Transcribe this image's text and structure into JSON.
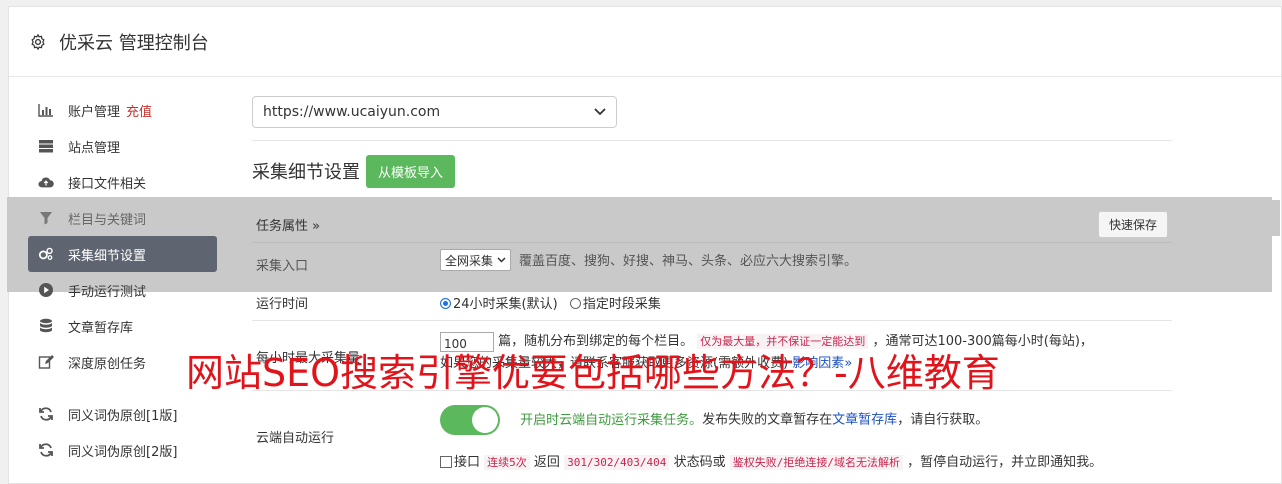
{
  "header": {
    "title": "优采云 管理控制台",
    "icon": "gear-icon"
  },
  "sidebar": {
    "items": [
      {
        "label": "账户管理",
        "extra": "充值",
        "icon": "bar-chart-icon"
      },
      {
        "label": "站点管理",
        "icon": "server-icon"
      },
      {
        "label": "接口文件相关",
        "icon": "cloud-upload-icon"
      },
      {
        "label": "栏目与关键词",
        "icon": "filter-icon"
      },
      {
        "label": "采集细节设置",
        "icon": "cogs-icon"
      },
      {
        "label": "手动运行测试",
        "icon": "play-circle-icon"
      },
      {
        "label": "文章暂存库",
        "icon": "database-icon"
      },
      {
        "label": "深度原创任务",
        "icon": "edit-icon"
      },
      {
        "label": "同义词伪原创[1版]",
        "icon": "refresh-icon"
      },
      {
        "label": "同义词伪原创[2版]",
        "icon": "refresh-icon"
      }
    ]
  },
  "site_select": {
    "value": "https://www.ucaiyun.com"
  },
  "section": {
    "title": "采集细节设置",
    "import_button": "从模板导入"
  },
  "task": {
    "attr_label": "任务属性",
    "quick_save": "快速保存"
  },
  "entry": {
    "label": "采集入口",
    "select_value": "全网采集",
    "desc": "覆盖百度、搜狗、好搜、神马、头条、必应六大搜索引擎。"
  },
  "runtime": {
    "label": "运行时间",
    "option1": "24小时采集(默认)",
    "option2": "指定时段采集"
  },
  "hourly": {
    "label": "每小时最大采集量",
    "value": "100",
    "text1": "篇，随机分布到绑定的每个栏目。",
    "code1": "仅为最大量，并不保证一定能达到",
    "text2": "，通常可达100-300篇每小时(每站)，",
    "line2_prefix": "如果您的采集量较大，请联系客服获取更多资源(需额外收费)",
    "line2_link": "影响因素"
  },
  "cloud": {
    "label": "云端自动运行",
    "green_text": "开启时云端自动运行采集任务。",
    "text1": "发布失败的文章暂存在",
    "link": "文章暂存库",
    "text2": "，请自行获取。",
    "cb_label": "接口",
    "code1": "连续5次",
    "text3": "返回",
    "code2": "301/302/403/404",
    "text4": "状态码或",
    "code3": "鉴权失败/拒绝连接/域名无法解析",
    "text5": "，暂停自动运行，并立即通知我。"
  },
  "watermark": {
    "text": "网站SEO搜索引擎优要包括哪些方法？-八维教育"
  }
}
